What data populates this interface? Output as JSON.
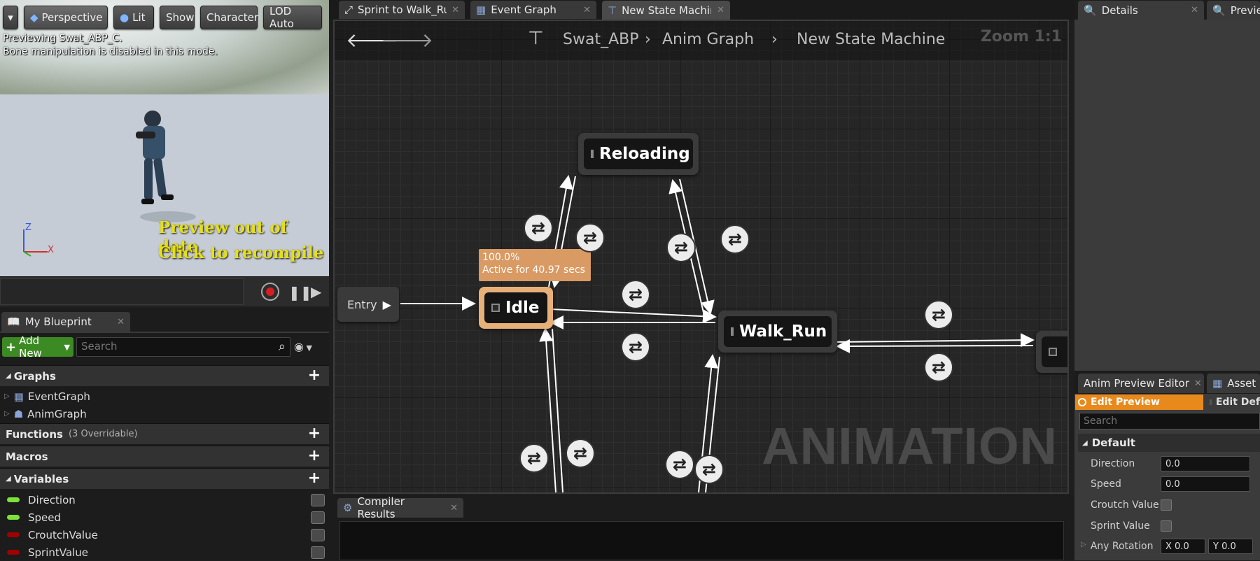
{
  "viewport": {
    "toolbar": {
      "perspective": "Perspective",
      "lit": "Lit",
      "show": "Show",
      "character": "Character",
      "lod": "LOD Auto"
    },
    "overlay_line1": "Previewing Swat_ABP_C.",
    "overlay_line2": "Bone manipulation is disabled in this mode.",
    "recompile_line1": "Preview out of date",
    "recompile_line2": "Click to recompile",
    "axis_z": "Z",
    "axis_x": "X"
  },
  "my_blueprint": {
    "tab_label": "My Blueprint",
    "add_new": "Add New",
    "search_placeholder": "Search",
    "graphs_title": "Graphs",
    "graphs": [
      "EventGraph",
      "AnimGraph"
    ],
    "functions_title": "Functions",
    "functions_sub": "(3 Overridable)",
    "macros_title": "Macros",
    "variables_title": "Variables",
    "variables": [
      {
        "name": "Direction",
        "color": "#7fe23a"
      },
      {
        "name": "Speed",
        "color": "#7fe23a"
      },
      {
        "name": "CroutchValue",
        "color": "#a00000"
      },
      {
        "name": "SprintValue",
        "color": "#a00000"
      }
    ]
  },
  "editor_tabs": [
    {
      "label": "Sprint to Walk_Run"
    },
    {
      "label": "Event Graph"
    },
    {
      "label": "New State Machine"
    }
  ],
  "graph": {
    "breadcrumb": {
      "root": "Swat_ABP",
      "level1": "Anim Graph",
      "level2": "New State Machine"
    },
    "zoom": "Zoom 1:1",
    "watermark": "ANIMATION",
    "entry_label": "Entry",
    "states": {
      "reloading": "Reloading",
      "idle": "Idle",
      "walk_run": "Walk_Run"
    },
    "tooltip_line1": "100.0%",
    "tooltip_line2": "Active for 40.97 secs"
  },
  "compiler": {
    "tab_label": "Compiler Results"
  },
  "right_panel": {
    "tabs": {
      "details": "Details",
      "preview": "Previe"
    },
    "anim_preview_tab": "Anim Preview Editor",
    "asset_tab": "Asset",
    "edit_preview": "Edit Preview",
    "edit_defaults": "Edit Def",
    "search_placeholder": "Search",
    "default_category": "Default",
    "props": [
      {
        "label": "Direction",
        "value": "0.0"
      },
      {
        "label": "Speed",
        "value": "0.0"
      },
      {
        "label": "Croutch Value"
      },
      {
        "label": "Sprint Value"
      }
    ],
    "any_rotation": "Any Rotation",
    "rot_x": "X 0.0",
    "rot_y": "Y 0.0"
  }
}
